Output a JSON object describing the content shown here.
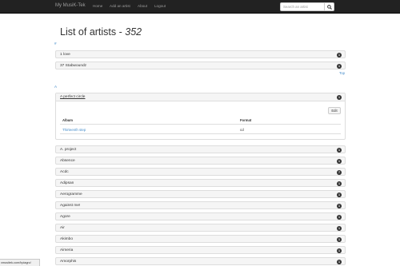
{
  "navbar": {
    "brand": "My MusiK-Tek",
    "links": [
      "Home",
      "Add an artist",
      "About",
      "Logout"
    ],
    "search_placeholder": "Search an artist"
  },
  "page": {
    "title": "List of artists - ",
    "count": "352"
  },
  "sections": [
    {
      "letter": "#",
      "top_label": "Top",
      "artists": [
        {
          "name": "1 love",
          "count": "1"
        },
        {
          "name": "37 Stabwoundz",
          "count": "1"
        }
      ]
    },
    {
      "letter": "A",
      "expanded": {
        "name": "A perfect circle",
        "count": "1",
        "edit_label": "Edit",
        "headers": [
          "Album",
          "Format"
        ],
        "albums": [
          {
            "title": "Thirteenth step",
            "format": "cd"
          }
        ]
      },
      "artists": [
        {
          "name": "A. project",
          "count": "1"
        },
        {
          "name": "Absence",
          "count": "1"
        },
        {
          "name": "Acdc",
          "count": "7"
        },
        {
          "name": "Adipsan",
          "count": "1"
        },
        {
          "name": "Aerogramme",
          "count": "1"
        },
        {
          "name": "Against me!",
          "count": "1"
        },
        {
          "name": "Agore",
          "count": "1"
        },
        {
          "name": "Air",
          "count": "1"
        },
        {
          "name": "Akimbo",
          "count": "1"
        },
        {
          "name": "Aimeria",
          "count": "1"
        },
        {
          "name": "Amorphis",
          "count": "1"
        }
      ]
    }
  ],
  "status_bar": {
    "url": "xmusitek.com/hpiagrc/"
  },
  "colors": {
    "navbar": "#222222",
    "link": "#428bca",
    "badge": "#333333",
    "row_bg": "#f5f5f5"
  }
}
